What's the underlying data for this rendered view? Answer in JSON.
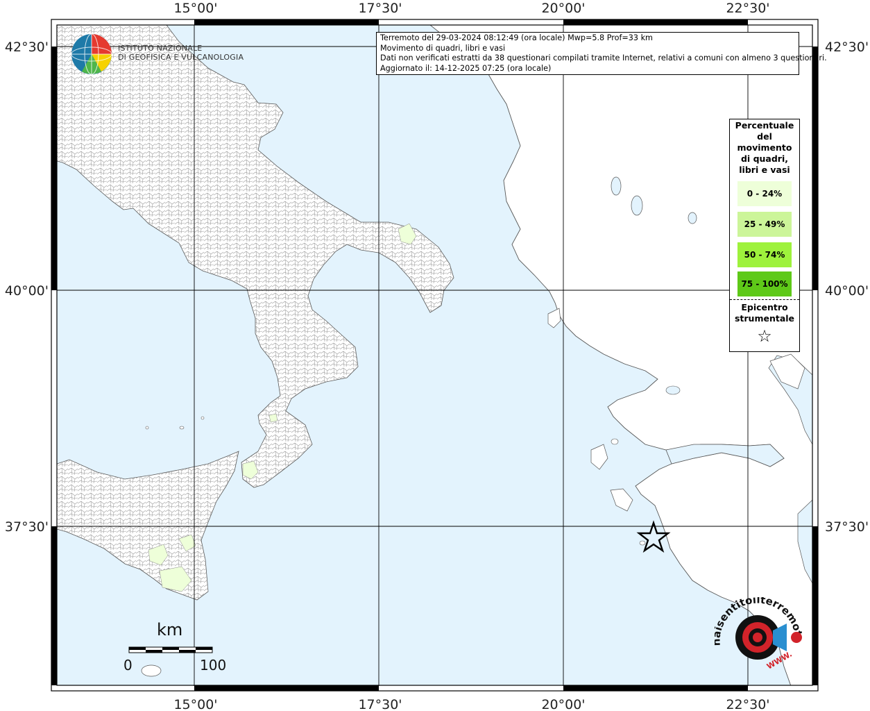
{
  "title_block": {
    "line1": "Terremoto del 29-03-2024 08:12:49 (ora locale) Mwp=5.8 Prof=33 km",
    "line2": "Movimento di quadri, libri e vasi",
    "line3": "Dati non verificati estratti da 38 questionari compilati tramite Internet, relativi a comuni con almeno 3 questionari.",
    "line4": "Aggiornato il: 14-12-2025 07:25 (ora locale)"
  },
  "institute": {
    "line1": "ISTITUTO NAZIONALE",
    "line2": "DI GEOFISICA E VULCANOLOGIA"
  },
  "axes": {
    "top_labels": [
      "15°00'",
      "17°30'",
      "20°00'",
      "22°30'"
    ],
    "bottom_labels": [
      "15°00'",
      "17°30'",
      "20°00'",
      "22°30'"
    ],
    "left_labels": [
      "42°30'",
      "40°00'",
      "37°30'"
    ],
    "right_labels": [
      "42°30'",
      "40°00'",
      "37°30'"
    ]
  },
  "legend": {
    "title": "Percentuale del movimento di quadri, libri e vasi",
    "title_lines": [
      "Percentuale",
      "del",
      "movimento",
      "di quadri,",
      "libri e vasi"
    ],
    "items": [
      {
        "label": "0 - 24%",
        "color": "#eeffd9"
      },
      {
        "label": "25 - 49%",
        "color": "#ccf599"
      },
      {
        "label": "50 - 74%",
        "color": "#9ef23c"
      },
      {
        "label": "75 - 100%",
        "color": "#5ec918"
      }
    ],
    "epicenter_lines": [
      "Epicentro",
      "strumentale"
    ]
  },
  "scale_bar": {
    "unit": "km",
    "min_label": "0",
    "max_label": "100"
  },
  "watermark": {
    "text": "haisentitoilterremoto.it",
    "site": "WWW."
  },
  "colors": {
    "sea": "#e3f3fd",
    "land": "#ffffff",
    "grid": "#000000"
  }
}
